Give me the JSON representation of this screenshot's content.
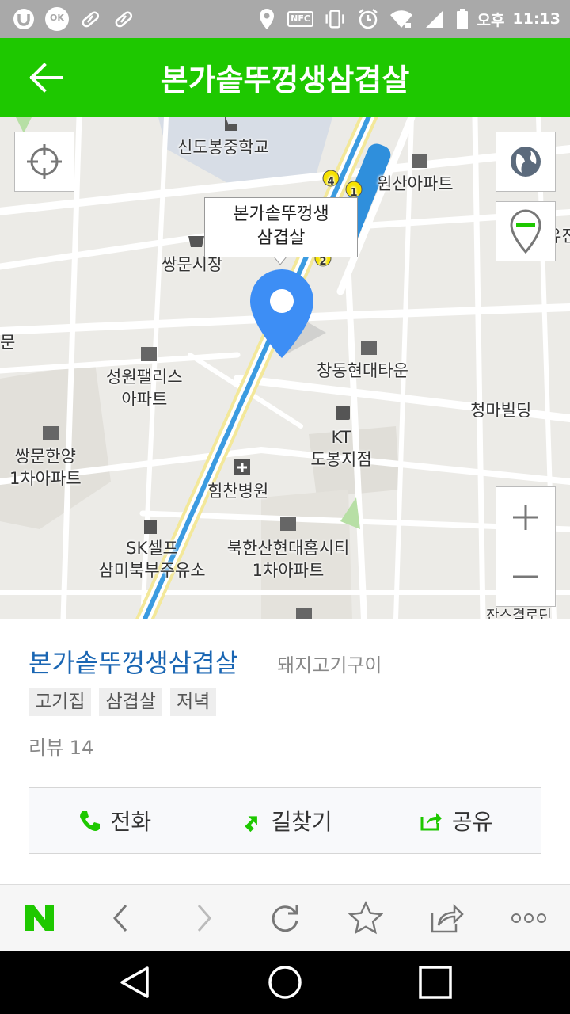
{
  "status_bar": {
    "time": "11:13",
    "ampm": "오후",
    "nfc": "NFC",
    "ok_badge": "OK",
    "icons": [
      "u-plus-icon",
      "ok-cashbag-icon",
      "pill-icon",
      "pill-icon",
      "location-icon",
      "nfc-icon",
      "vibrate-icon",
      "alarm-icon",
      "wifi-icon",
      "signal-icon",
      "battery-icon"
    ]
  },
  "header": {
    "title": "본가솥뚜껑생삼겹살",
    "back_icon": "arrow-left-icon"
  },
  "map": {
    "callout": {
      "line1": "본가솥뚜껑생",
      "line2": "삼겹살"
    },
    "labels": {
      "school": "신도봉중학교",
      "wonsan": "원산아파트",
      "market": "쌍문시장",
      "seongwon1": "성원팰리스",
      "seongwon2": "아파트",
      "changdong": "창동현대타운",
      "cheongma": "청마빌딩",
      "kt1": "KT",
      "kt2": "도봉지점",
      "ssangmun1": "쌍문한양",
      "ssangmun2": "1차아파트",
      "himchan": "힘찬병원",
      "sk1": "SK셀프",
      "sk2": "삼미북부주유소",
      "bukhan1": "북한산현대홈시티",
      "bukhan2": "1차아파트",
      "edge_left": "문",
      "edge_right": "유진",
      "edge_bottom": "잔스결로딘"
    },
    "subway_exits": [
      "4",
      "1",
      "2"
    ],
    "controls": {
      "locate": "crosshair-icon",
      "globe": "globe-icon",
      "layer": "pin-layer-icon",
      "zoom_in": "plus-icon",
      "zoom_out": "minus-icon"
    },
    "colors": {
      "subway_line": "#3b9be0",
      "pin": "#3d8ef5",
      "road": "#ffffff",
      "block": "#ecebe7",
      "highlight_road": "#f3e89a"
    }
  },
  "info": {
    "name": "본가솥뚜껑생삼겹살",
    "category": "돼지고기구이",
    "tags": [
      "고기집",
      "삼겹살",
      "저녁"
    ],
    "review": "리뷰 14",
    "actions": [
      {
        "label": "전화",
        "icon": "phone-icon"
      },
      {
        "label": "길찾기",
        "icon": "directions-icon"
      },
      {
        "label": "공유",
        "icon": "share-icon"
      }
    ]
  },
  "toolbar": {
    "items": [
      "naver-n-icon",
      "back-chevron-icon",
      "forward-chevron-icon",
      "refresh-icon",
      "star-icon",
      "share-out-icon",
      "more-dots-icon"
    ]
  },
  "navbar": {
    "items": [
      "back-triangle-icon",
      "home-circle-icon",
      "recents-square-icon"
    ]
  },
  "brand": {
    "green": "#1ec800",
    "blue": "#1a66b3"
  }
}
